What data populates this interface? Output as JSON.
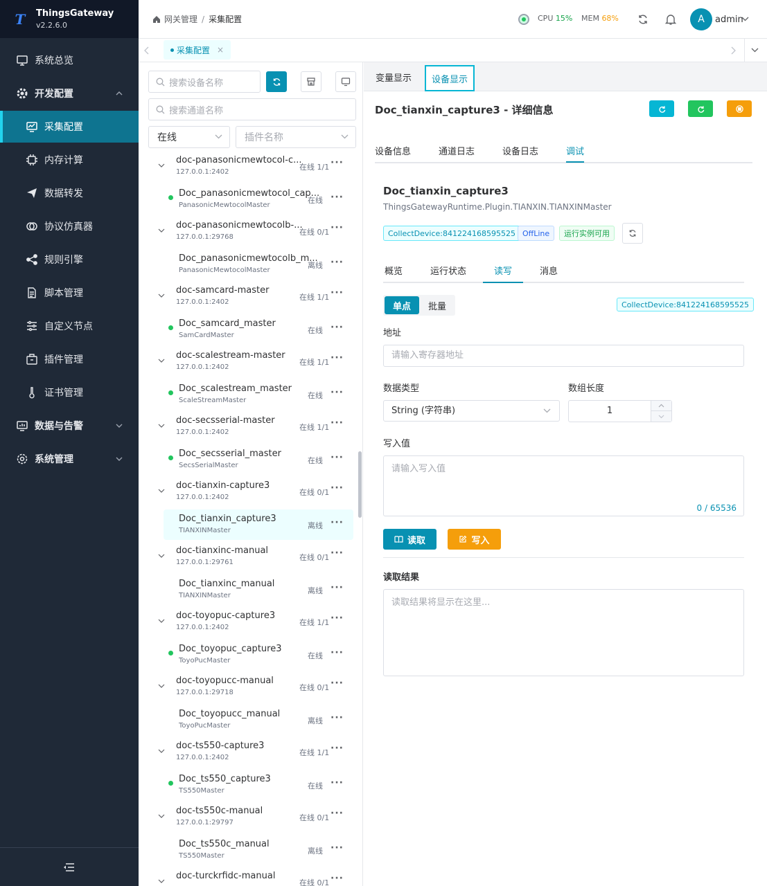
{
  "app": {
    "name": "ThingsGateway",
    "version": "v2.2.6.0",
    "logo_letter": "T"
  },
  "sidebar": {
    "items": [
      {
        "label": "系统总览"
      },
      {
        "label": "开发配置"
      },
      {
        "label": "采集配置"
      },
      {
        "label": "内存计算"
      },
      {
        "label": "数据转发"
      },
      {
        "label": "协议仿真器"
      },
      {
        "label": "规则引擎"
      },
      {
        "label": "脚本管理"
      },
      {
        "label": "自定义节点"
      },
      {
        "label": "插件管理"
      },
      {
        "label": "证书管理"
      },
      {
        "label": "数据与告警"
      },
      {
        "label": "系统管理"
      }
    ]
  },
  "header": {
    "breadcrumb": [
      "网关管理",
      "采集配置"
    ],
    "cpu_label": "CPU",
    "cpu_value": "15%",
    "mem_label": "MEM",
    "mem_value": "68%",
    "avatar_letter": "A",
    "user": "admin"
  },
  "tabbar": {
    "open_tab": "采集配置",
    "close_glyph": "×"
  },
  "left": {
    "search_device_placeholder": "搜索设备名称",
    "search_channel_placeholder": "搜索通道名称",
    "status_select": "在线",
    "plugin_select_placeholder": "插件名称",
    "tree": [
      {
        "title": "doc-panasonicmewtocol-c...",
        "sub": "127.0.0.1:2402",
        "count": "在线 1/1",
        "device": "Doc_panasonicmewtocol_cap...",
        "plugin": "PanasonicMewtocolMaster",
        "status": "在线",
        "online": true
      },
      {
        "title": "doc-panasonicmewtocolb-...",
        "sub": "127.0.0.1:29768",
        "count": "在线 0/1",
        "device": "Doc_panasonicmewtocolb_m...",
        "plugin": "PanasonicMewtocolMaster",
        "status": "离线",
        "online": false
      },
      {
        "title": "doc-samcard-master",
        "sub": "127.0.0.1:2402",
        "count": "在线 1/1",
        "device": "Doc_samcard_master",
        "plugin": "SamCardMaster",
        "status": "在线",
        "online": true
      },
      {
        "title": "doc-scalestream-master",
        "sub": "127.0.0.1:2402",
        "count": "在线 1/1",
        "device": "Doc_scalestream_master",
        "plugin": "ScaleStreamMaster",
        "status": "在线",
        "online": true
      },
      {
        "title": "doc-secsserial-master",
        "sub": "127.0.0.1:2402",
        "count": "在线 1/1",
        "device": "Doc_secsserial_master",
        "plugin": "SecsSerialMaster",
        "status": "在线",
        "online": true
      },
      {
        "title": "doc-tianxin-capture3",
        "sub": "127.0.0.1:2402",
        "count": "在线 0/1",
        "device": "Doc_tianxin_capture3",
        "plugin": "TIANXINMaster",
        "status": "离线",
        "online": false,
        "selected": true
      },
      {
        "title": "doc-tianxinc-manual",
        "sub": "127.0.0.1:29761",
        "count": "在线 0/1",
        "device": "Doc_tianxinc_manual",
        "plugin": "TIANXINMaster",
        "status": "离线",
        "online": false
      },
      {
        "title": "doc-toyopuc-capture3",
        "sub": "127.0.0.1:2402",
        "count": "在线 1/1",
        "device": "Doc_toyopuc_capture3",
        "plugin": "ToyoPucMaster",
        "status": "在线",
        "online": true
      },
      {
        "title": "doc-toyopucc-manual",
        "sub": "127.0.0.1:29718",
        "count": "在线 0/1",
        "device": "Doc_toyopucc_manual",
        "plugin": "ToyoPucMaster",
        "status": "离线",
        "online": false
      },
      {
        "title": "doc-ts550-capture3",
        "sub": "127.0.0.1:2402",
        "count": "在线 1/1",
        "device": "Doc_ts550_capture3",
        "plugin": "TS550Master",
        "status": "在线",
        "online": true
      },
      {
        "title": "doc-ts550c-manual",
        "sub": "127.0.0.1:29797",
        "count": "在线 0/1",
        "device": "Doc_ts550c_manual",
        "plugin": "TS550Master",
        "status": "离线",
        "online": false
      },
      {
        "title": "doc-turckrfidc-manual",
        "sub": "",
        "count": "在线 0/1"
      }
    ]
  },
  "right": {
    "tabs": [
      "变量显示",
      "设备显示"
    ],
    "title": "Doc_tianxin_capture3 - 详细信息",
    "subtabs": [
      "设备信息",
      "通道日志",
      "设备日志",
      "调试"
    ],
    "device_name": "Doc_tianxin_capture3",
    "plugin_path": "ThingsGatewayRuntime.Plugin.TIANXIN.TIANXINMaster",
    "tags": [
      "CollectDevice:841224168595525",
      "OffLine",
      "运行实例可用"
    ],
    "inner_tabs": [
      "概览",
      "运行状态",
      "读写",
      "消息"
    ],
    "mode": [
      "单点",
      "批量"
    ],
    "collect_tag": "CollectDevice:841224168595525",
    "address_label": "地址",
    "address_placeholder": "请输入寄存器地址",
    "type_label": "数据类型",
    "type_value": "String (字符串)",
    "length_label": "数组长度",
    "length_value": "1",
    "write_label": "写入值",
    "write_placeholder": "请输入写入值",
    "counter": "0 / 65536",
    "read_btn": "读取",
    "write_btn": "写入",
    "result_label": "读取结果",
    "result_placeholder": "读取结果将显示在这里..."
  }
}
